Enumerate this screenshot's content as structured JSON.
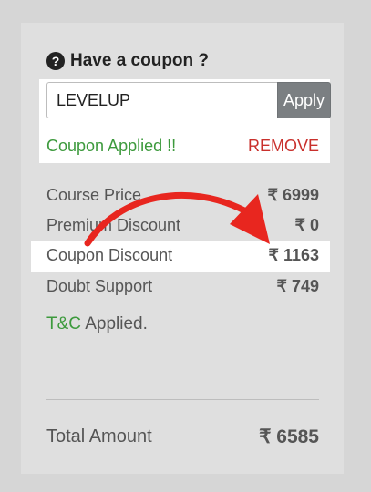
{
  "coupon": {
    "heading": "Have a coupon ?",
    "help_icon": "question-circle-icon",
    "input_value": "LEVELUP",
    "apply_label": "Apply",
    "status_text": "Coupon Applied !!",
    "remove_label": "REMOVE"
  },
  "summary": {
    "lines": [
      {
        "label": "Course Price",
        "amount": "₹ 6999"
      },
      {
        "label": "Premium Discount",
        "amount": "₹ 0"
      },
      {
        "label": "Coupon Discount",
        "amount": "₹ 1163"
      },
      {
        "label": "Doubt Support",
        "amount": "₹ 749"
      }
    ],
    "tc_link": "T&C",
    "tc_suffix": " Applied.",
    "total_label": "Total Amount",
    "total_amount": "₹ 6585"
  },
  "colors": {
    "green": "#3d9a3d",
    "red": "#c9302c",
    "arrow": "#e8261f"
  }
}
